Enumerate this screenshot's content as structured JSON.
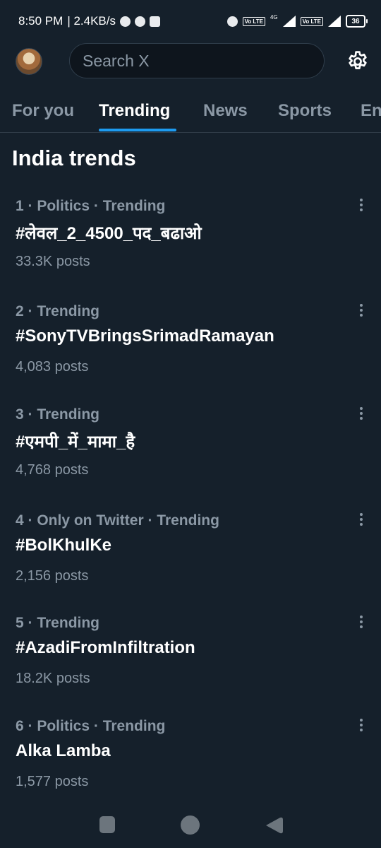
{
  "status_bar": {
    "time": "8:50 PM",
    "speed": "| 2.4KB/s",
    "network": "4G",
    "volte1": "Vo LTE",
    "volte2": "Vo LTE",
    "battery": "36"
  },
  "header": {
    "search_placeholder": "Search X"
  },
  "tabs": [
    {
      "label": "For you"
    },
    {
      "label": "Trending"
    },
    {
      "label": "News"
    },
    {
      "label": "Sports"
    },
    {
      "label": "En"
    }
  ],
  "active_tab": "Trending",
  "section_title": "India trends",
  "trends": [
    {
      "meta": "1 · Politics · Trending",
      "name": "#लेवल_2_4500_पद_बढाओ",
      "count": "33.3K posts"
    },
    {
      "meta": "2 · Trending",
      "name": "#SonyTVBringsSrimadRamayan",
      "count": "4,083 posts"
    },
    {
      "meta": "3 · Trending",
      "name": "#एमपी_में_मामा_है",
      "count": "4,768 posts"
    },
    {
      "meta": "4 · Only on Twitter · Trending",
      "name": "#BolKhulKe",
      "count": "2,156 posts"
    },
    {
      "meta": "5 · Trending",
      "name": "#AzadiFromInfiltration",
      "count": "18.2K posts"
    },
    {
      "meta": "6 · Politics · Trending",
      "name": "Alka Lamba",
      "count": "1,577 posts"
    }
  ],
  "colors": {
    "background": "#15202b",
    "accent": "#1d9bf0",
    "secondary_text": "#8b98a5"
  },
  "icons": {
    "settings": "gear-icon",
    "more": "more-vertical-icon",
    "nav_recents": "square-icon",
    "nav_home": "circle-icon",
    "nav_back": "triangle-back-icon"
  }
}
